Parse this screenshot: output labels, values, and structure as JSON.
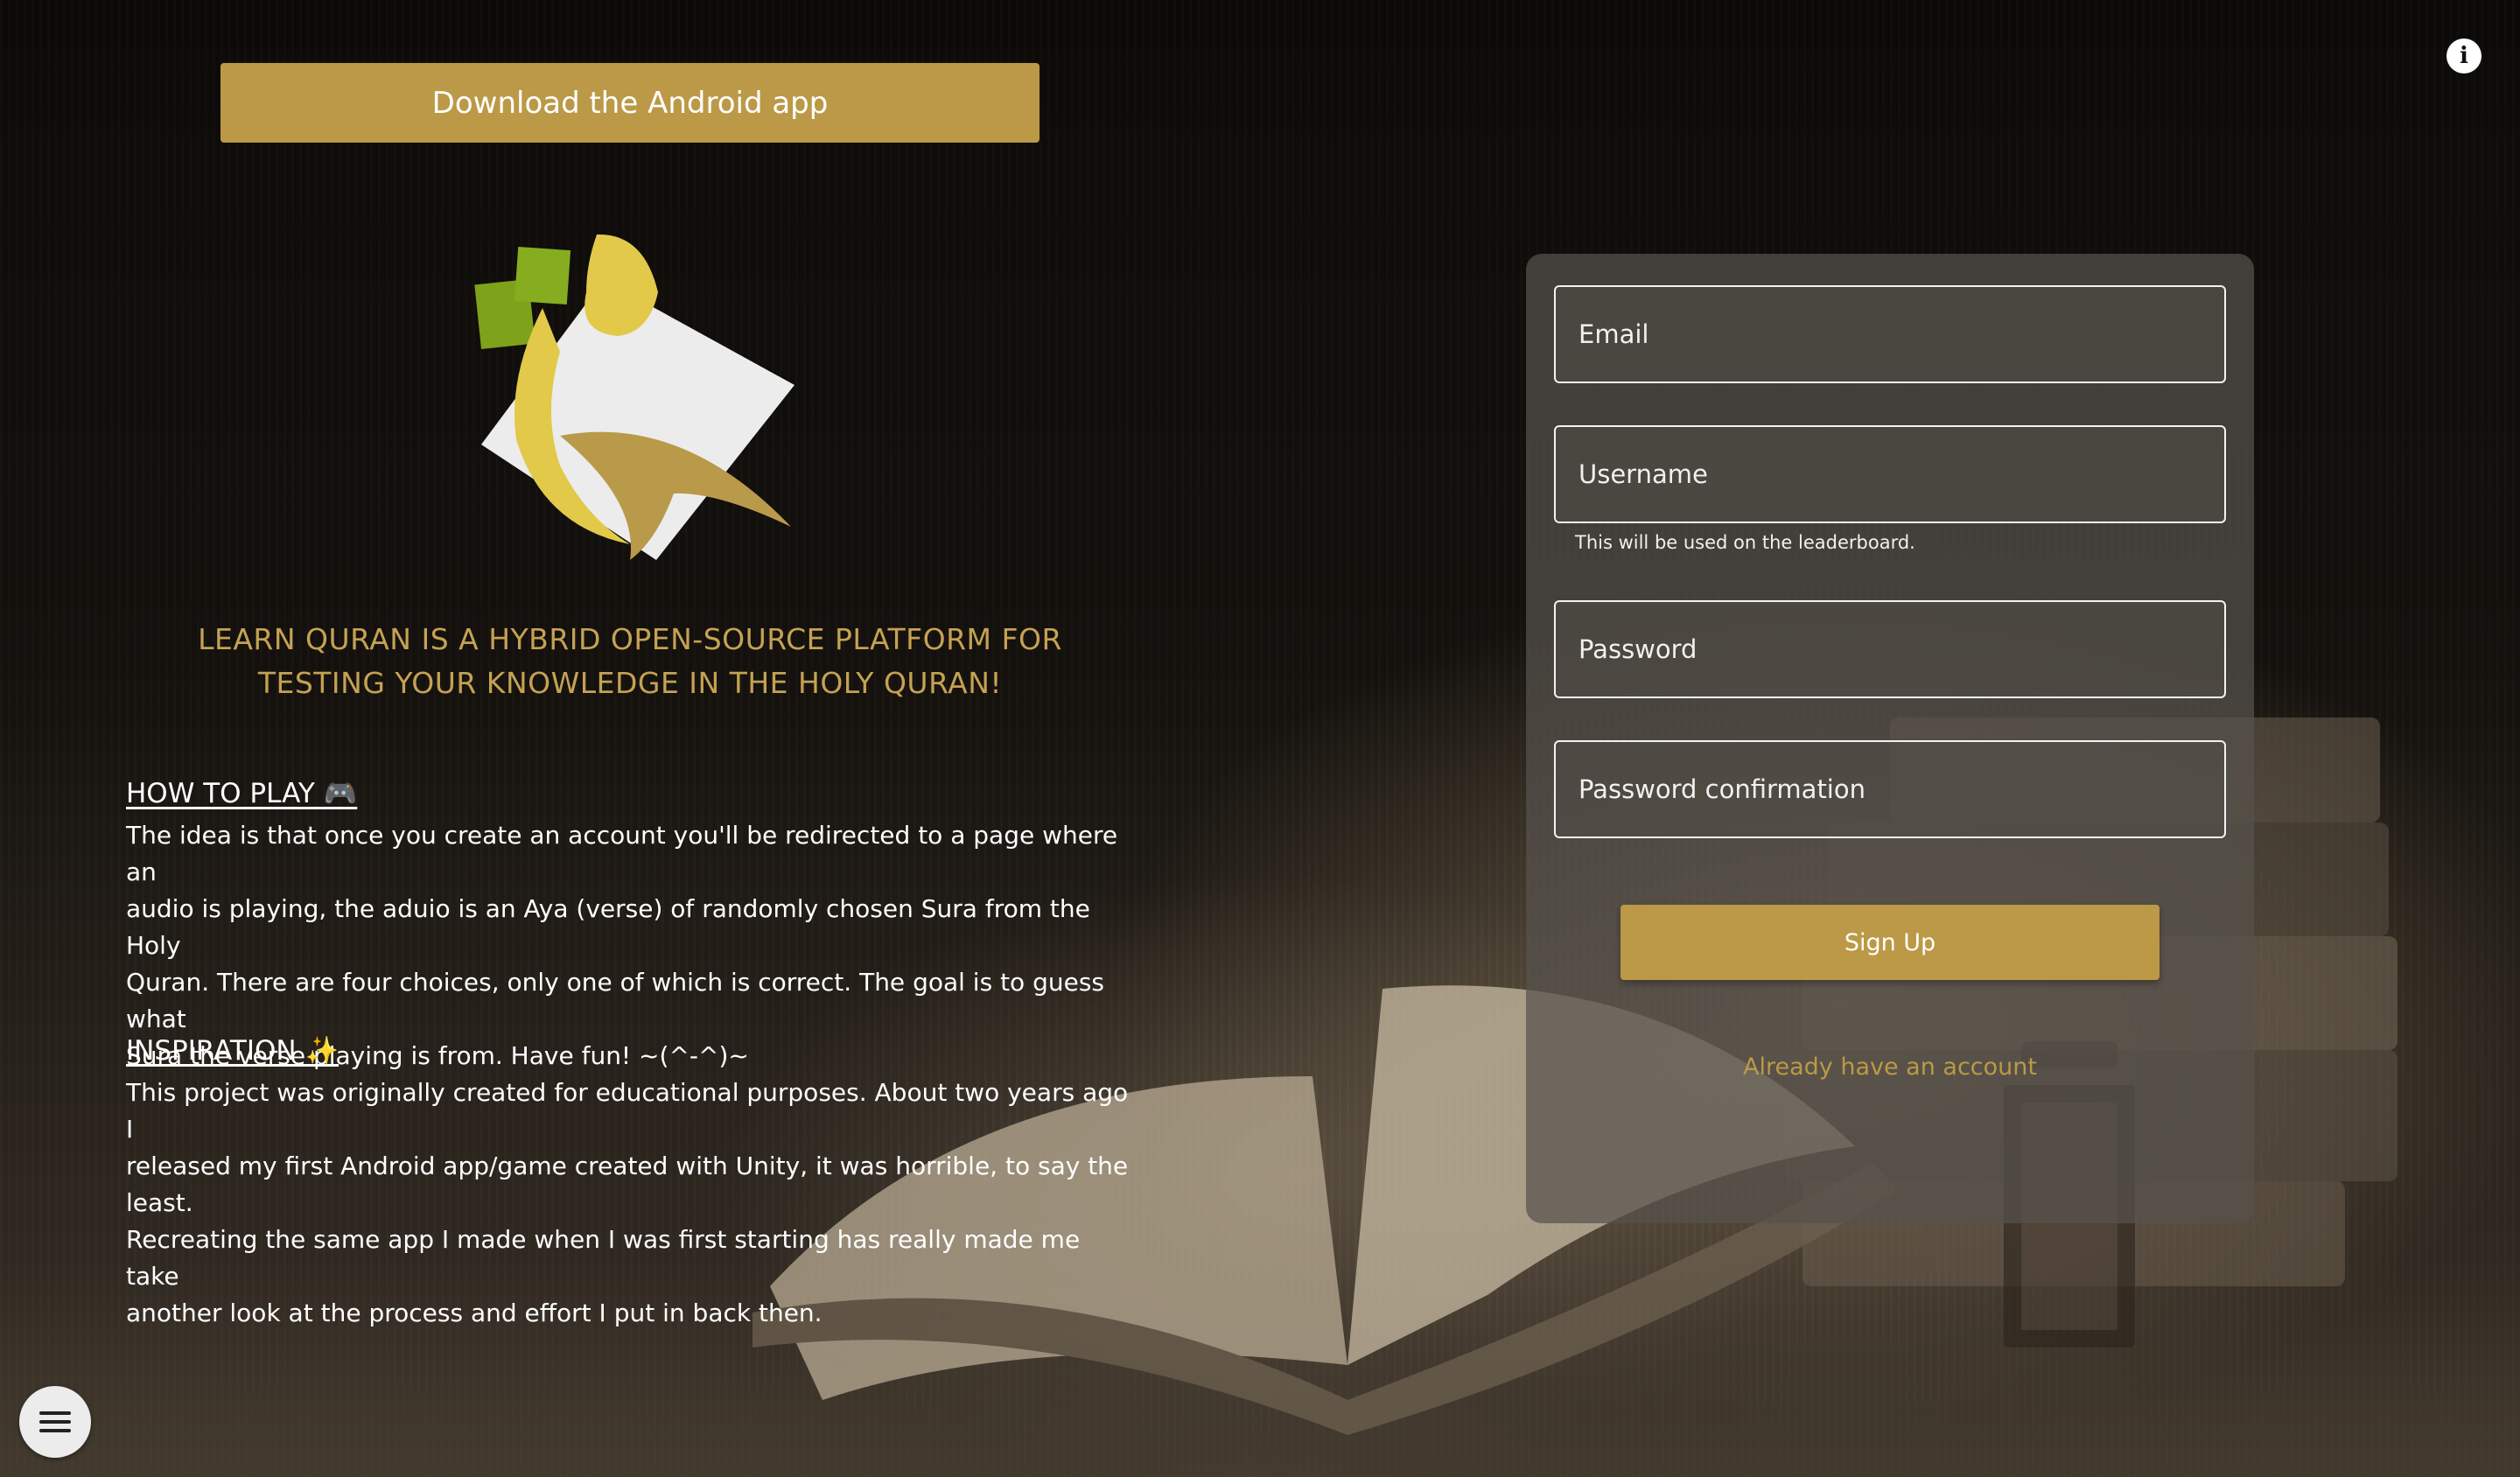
{
  "header": {
    "download_label": "Download the Android app",
    "info_icon": "info-icon"
  },
  "intro": {
    "tagline": "LEARN QURAN IS A HYBRID OPEN-SOURCE PLATFORM FOR TESTING YOUR KNOWLEDGE IN THE HOLY QURAN!"
  },
  "how_to_play": {
    "title": "HOW TO PLAY 🎮",
    "lines": [
      "The idea is that once you create an account you'll be redirected to a page where an",
      "audio is playing, the aduio is an Aya (verse) of randomly chosen Sura from the Holy",
      "Quran. There are four choices, only one of which is correct. The goal is to guess what",
      "Sura the verse playing is from. Have fun! ~(^-^)~"
    ]
  },
  "inspiration": {
    "title": "INSPIRATION ✨",
    "lines": [
      "This project was originally created for educational purposes. About two years ago I",
      "released my first Android app/game created with Unity, it was horrible, to say the least.",
      "Recreating the same app I made when I was first starting has really made me take",
      "another look at the process and effort I put in back then."
    ]
  },
  "signup_form": {
    "email_placeholder": "Email",
    "username_placeholder": "Username",
    "username_helper": "This will be used on the leaderboard.",
    "password_placeholder": "Password",
    "password_confirmation_placeholder": "Password confirmation",
    "submit_label": "Sign Up",
    "signin_link": "Already have an account"
  },
  "colors": {
    "accent_gold": "#bb9946",
    "tagline_gold": "#c5a253",
    "logo_green": "#7ea21a",
    "logo_yellow": "#e2c94a",
    "logo_tan": "#b89a4a"
  },
  "icons": {
    "menu": "hamburger-menu-icon",
    "info": "info-icon"
  }
}
